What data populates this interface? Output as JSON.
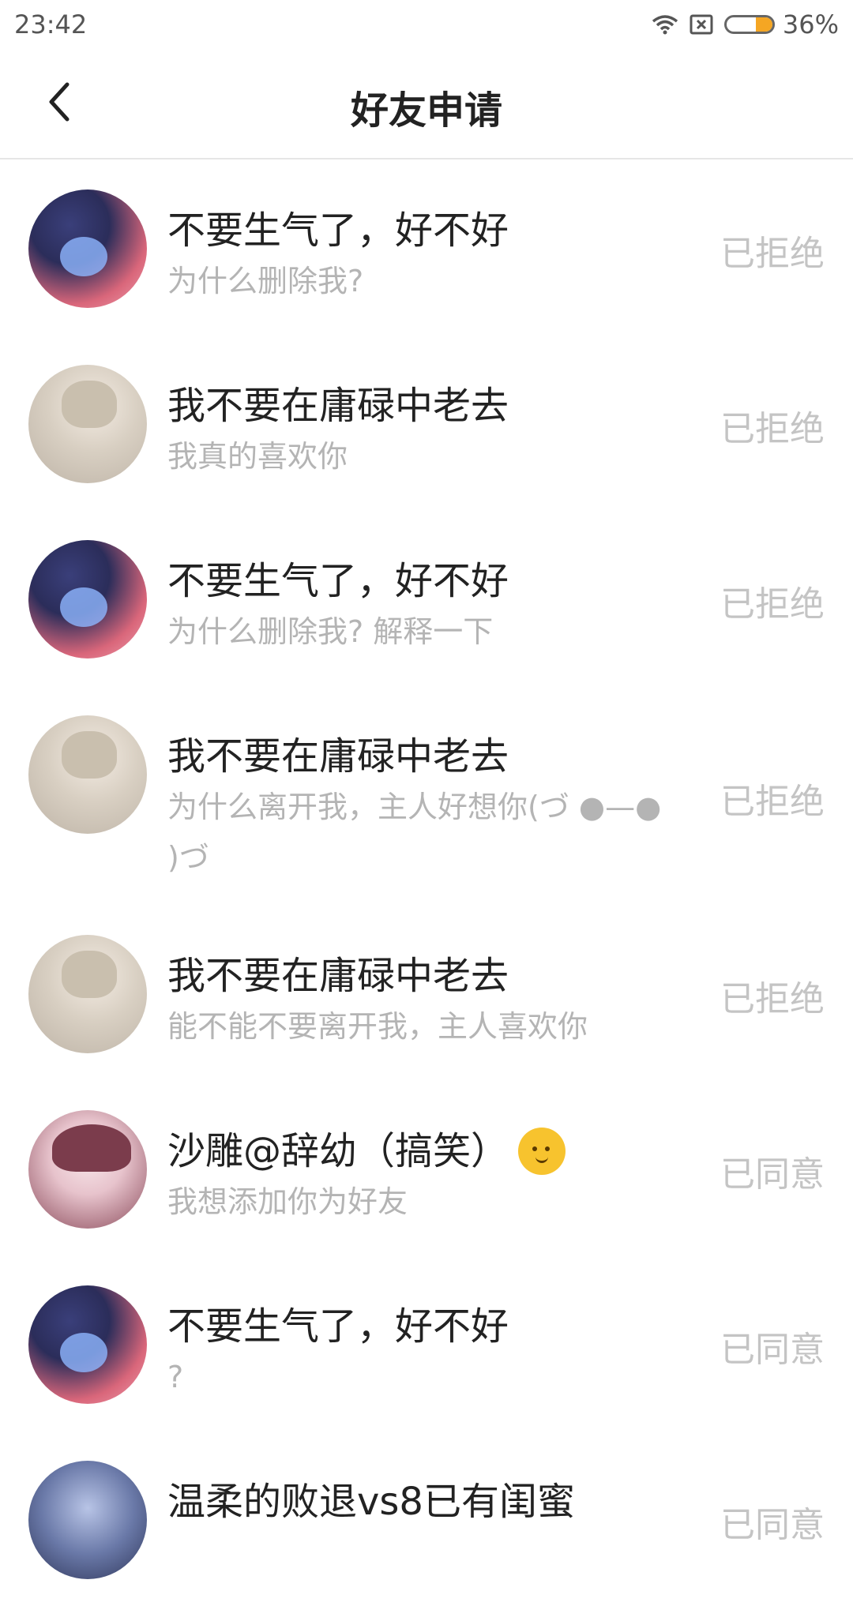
{
  "status_bar": {
    "time": "23:42",
    "battery_percent": "36%",
    "battery_level": 0.36,
    "icons": [
      "wifi-icon",
      "sim-x-icon",
      "battery-icon"
    ]
  },
  "header": {
    "title": "好友申请",
    "back_icon": "chevron-left-icon"
  },
  "requests": [
    {
      "name": "不要生气了，好不好",
      "message": "为什么删除我?",
      "status": "已拒绝",
      "avatar": "avatar-a"
    },
    {
      "name": "我不要在庸碌中老去",
      "message": "我真的喜欢你",
      "status": "已拒绝",
      "avatar": "avatar-b"
    },
    {
      "name": "不要生气了，好不好",
      "message": "为什么删除我? 解释一下",
      "status": "已拒绝",
      "avatar": "avatar-a"
    },
    {
      "name": "我不要在庸碌中老去",
      "message": "为什么离开我，主人好想你(づ ●—● )づ",
      "status": "已拒绝",
      "avatar": "avatar-b"
    },
    {
      "name": "我不要在庸碌中老去",
      "message": "能不能不要离开我，主人喜欢你",
      "status": "已拒绝",
      "avatar": "avatar-b"
    },
    {
      "name": "沙雕@辞幼（搞笑）",
      "message": "我想添加你为好友",
      "status": "已同意",
      "avatar": "avatar-c",
      "emoji": "smiley-face-icon"
    },
    {
      "name": "不要生气了，好不好",
      "message": "?",
      "status": "已同意",
      "avatar": "avatar-a"
    },
    {
      "name": "温柔的败退vs8已有闺蜜",
      "message": "",
      "status": "已同意",
      "avatar": "avatar-d"
    }
  ],
  "colors": {
    "name_text": "#222222",
    "message_text": "#b4b4b4",
    "status_text": "#c4c4c4",
    "battery_fill": "#f5a623",
    "divider": "#e6e6e6"
  }
}
